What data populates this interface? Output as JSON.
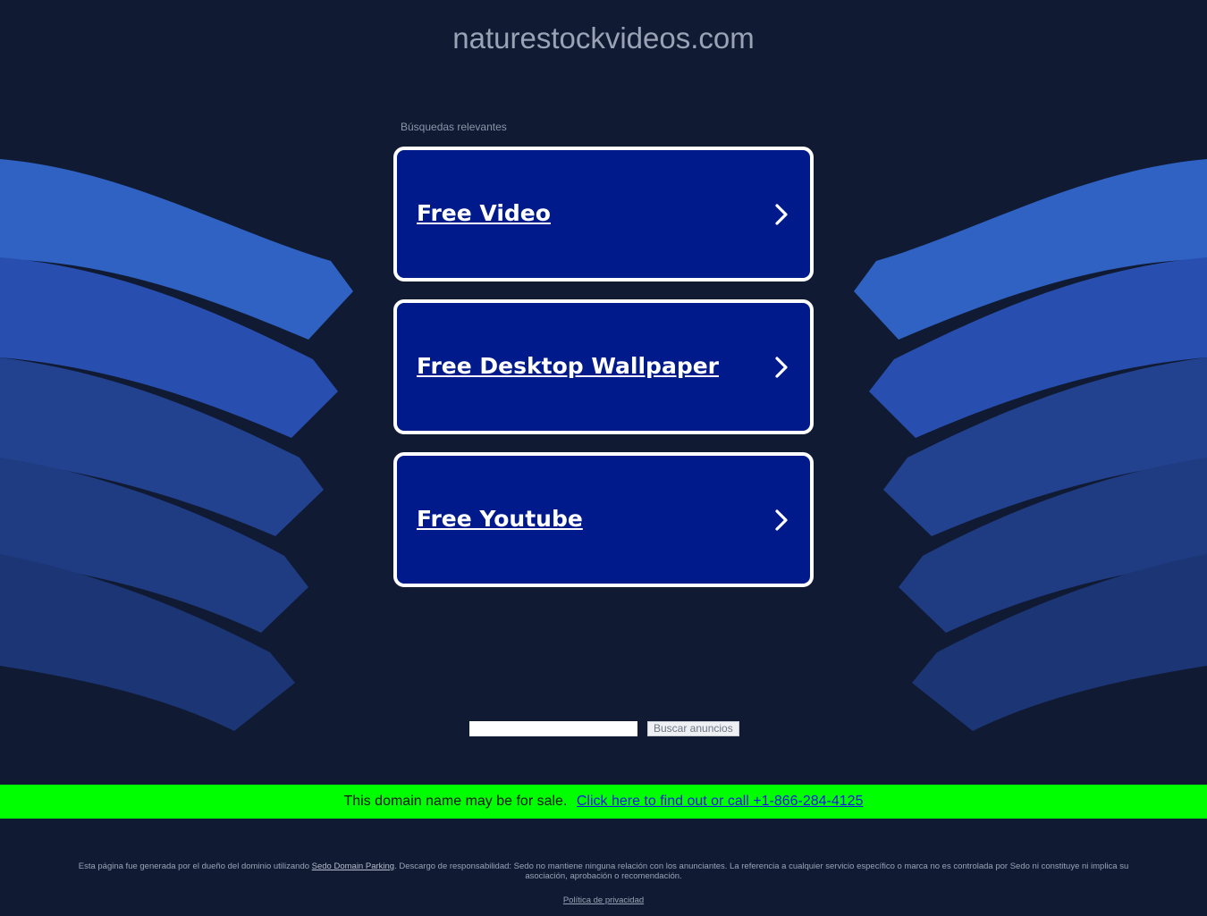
{
  "header": {
    "domain": "naturestockvideos.com"
  },
  "related": {
    "label": "Búsquedas relevantes",
    "links": [
      {
        "label": "Free Video"
      },
      {
        "label": "Free Desktop Wallpaper"
      },
      {
        "label": "Free Youtube"
      }
    ]
  },
  "search": {
    "value": "",
    "button_label": "Buscar anuncios"
  },
  "sale_banner": {
    "text": "This domain name may be for sale.",
    "link_text": "Click here to find out or call +1-866-284-4125"
  },
  "footer": {
    "disclaimer_before": "Esta página fue generada por el dueño del dominio utilizando ",
    "disclaimer_link": "Sedo Domain Parking",
    "disclaimer_after": ". Descargo de responsabilidad: Sedo no mantiene ninguna relación con los anunciantes. La referencia a cualquier servicio específico o marca no es controlada por Sedo ni constituye ni implica su asociación, aprobación o recomendación.",
    "privacy_link": "Política de privacidad"
  },
  "colors": {
    "background": "#101a33",
    "link_card": "#001a8c",
    "sale_banner": "#00ff00",
    "wave_light": "#2f62c2",
    "wave_dark": "#1f3d88"
  },
  "icons": {
    "link_arrow": "chevron-right-icon"
  }
}
